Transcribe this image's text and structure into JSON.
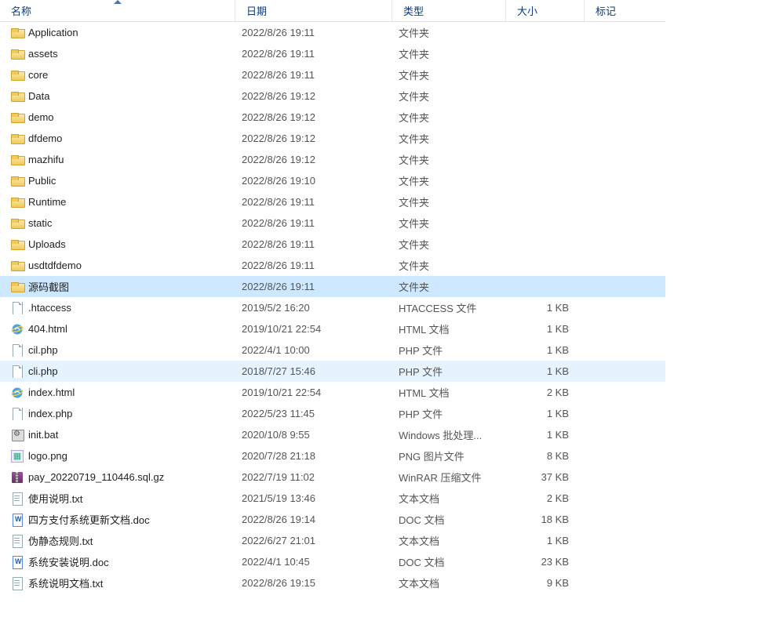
{
  "columns": {
    "name": "名称",
    "date": "日期",
    "type": "类型",
    "size": "大小",
    "tags": "标记"
  },
  "sort": {
    "column": "name",
    "direction": "asc"
  },
  "items": [
    {
      "icon": "folder",
      "name": "Application",
      "date": "2022/8/26 19:11",
      "type": "文件夹",
      "size": "",
      "state": ""
    },
    {
      "icon": "folder",
      "name": "assets",
      "date": "2022/8/26 19:11",
      "type": "文件夹",
      "size": "",
      "state": ""
    },
    {
      "icon": "folder",
      "name": "core",
      "date": "2022/8/26 19:11",
      "type": "文件夹",
      "size": "",
      "state": ""
    },
    {
      "icon": "folder",
      "name": "Data",
      "date": "2022/8/26 19:12",
      "type": "文件夹",
      "size": "",
      "state": ""
    },
    {
      "icon": "folder",
      "name": "demo",
      "date": "2022/8/26 19:12",
      "type": "文件夹",
      "size": "",
      "state": ""
    },
    {
      "icon": "folder",
      "name": "dfdemo",
      "date": "2022/8/26 19:12",
      "type": "文件夹",
      "size": "",
      "state": ""
    },
    {
      "icon": "folder",
      "name": "mazhifu",
      "date": "2022/8/26 19:12",
      "type": "文件夹",
      "size": "",
      "state": ""
    },
    {
      "icon": "folder",
      "name": "Public",
      "date": "2022/8/26 19:10",
      "type": "文件夹",
      "size": "",
      "state": ""
    },
    {
      "icon": "folder",
      "name": "Runtime",
      "date": "2022/8/26 19:11",
      "type": "文件夹",
      "size": "",
      "state": ""
    },
    {
      "icon": "folder",
      "name": "static",
      "date": "2022/8/26 19:11",
      "type": "文件夹",
      "size": "",
      "state": ""
    },
    {
      "icon": "folder",
      "name": "Uploads",
      "date": "2022/8/26 19:11",
      "type": "文件夹",
      "size": "",
      "state": ""
    },
    {
      "icon": "folder",
      "name": "usdtdfdemo",
      "date": "2022/8/26 19:11",
      "type": "文件夹",
      "size": "",
      "state": ""
    },
    {
      "icon": "folder",
      "name": "源码截图",
      "date": "2022/8/26 19:11",
      "type": "文件夹",
      "size": "",
      "state": "selected"
    },
    {
      "icon": "file",
      "name": ".htaccess",
      "date": "2019/5/2 16:20",
      "type": "HTACCESS 文件",
      "size": "1 KB",
      "state": ""
    },
    {
      "icon": "html",
      "name": "404.html",
      "date": "2019/10/21 22:54",
      "type": "HTML 文档",
      "size": "1 KB",
      "state": ""
    },
    {
      "icon": "file",
      "name": "cil.php",
      "date": "2022/4/1 10:00",
      "type": "PHP 文件",
      "size": "1 KB",
      "state": ""
    },
    {
      "icon": "file",
      "name": "cli.php",
      "date": "2018/7/27 15:46",
      "type": "PHP 文件",
      "size": "1 KB",
      "state": "hover"
    },
    {
      "icon": "html",
      "name": "index.html",
      "date": "2019/10/21 22:54",
      "type": "HTML 文档",
      "size": "2 KB",
      "state": ""
    },
    {
      "icon": "file",
      "name": "index.php",
      "date": "2022/5/23 11:45",
      "type": "PHP 文件",
      "size": "1 KB",
      "state": ""
    },
    {
      "icon": "bat",
      "name": "init.bat",
      "date": "2020/10/8 9:55",
      "type": "Windows 批处理...",
      "size": "1 KB",
      "state": ""
    },
    {
      "icon": "png",
      "name": "logo.png",
      "date": "2020/7/28 21:18",
      "type": "PNG 图片文件",
      "size": "8 KB",
      "state": ""
    },
    {
      "icon": "arch",
      "name": "pay_20220719_110446.sql.gz",
      "date": "2022/7/19 11:02",
      "type": "WinRAR 压缩文件",
      "size": "37 KB",
      "state": ""
    },
    {
      "icon": "txt",
      "name": "使用说明.txt",
      "date": "2021/5/19 13:46",
      "type": "文本文档",
      "size": "2 KB",
      "state": ""
    },
    {
      "icon": "doc",
      "name": "四方支付系统更新文档.doc",
      "date": "2022/8/26 19:14",
      "type": "DOC 文档",
      "size": "18 KB",
      "state": ""
    },
    {
      "icon": "txt",
      "name": "伪静态规则.txt",
      "date": "2022/6/27 21:01",
      "type": "文本文档",
      "size": "1 KB",
      "state": ""
    },
    {
      "icon": "doc",
      "name": "系统安装说明.doc",
      "date": "2022/4/1 10:45",
      "type": "DOC 文档",
      "size": "23 KB",
      "state": ""
    },
    {
      "icon": "txt",
      "name": "系统说明文档.txt",
      "date": "2022/8/26 19:15",
      "type": "文本文档",
      "size": "9 KB",
      "state": ""
    }
  ]
}
